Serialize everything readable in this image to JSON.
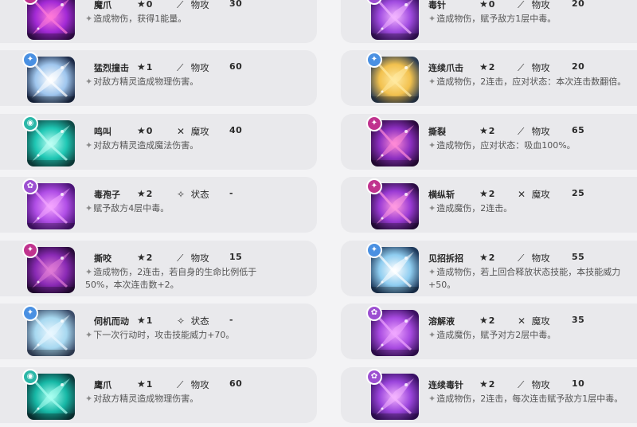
{
  "colors": {
    "badge_physical": "#4a90e2",
    "badge_magic": "#2bb7a8",
    "badge_poison": "#9c4fd1",
    "badge_dark": "#c0338e"
  },
  "skills": [
    {
      "name": "魔爪",
      "cost": "0",
      "type_icon": "dagger-icon",
      "type": "物攻",
      "power": "30",
      "desc": "造成物伤，获得1能量。",
      "badge_color": "#c0338e",
      "badge_glyph": "✦",
      "art": [
        "#3a0f55",
        "#a32ad6",
        "#ff7ad8"
      ]
    },
    {
      "name": "猛烈撞击",
      "cost": "1",
      "type_icon": "dagger-icon",
      "type": "物攻",
      "power": "60",
      "desc": "对敌方精灵造成物理伤害。",
      "badge_color": "#4a90e2",
      "badge_glyph": "✦",
      "art": [
        "#1d2b48",
        "#9fc6ee",
        "#ffffff"
      ]
    },
    {
      "name": "鸣叫",
      "cost": "0",
      "type_icon": "wand-icon",
      "type": "魔攻",
      "power": "40",
      "desc": "对敌方精灵造成魔法伤害。",
      "badge_color": "#2bb7a8",
      "badge_glyph": "◉",
      "art": [
        "#0f4b48",
        "#1fc7b4",
        "#bdfff4"
      ]
    },
    {
      "name": "毒孢子",
      "cost": "2",
      "type_icon": "sparkle-icon",
      "type": "状态",
      "power": "-",
      "desc": "赋予敌方4层中毒。",
      "badge_color": "#9c4fd1",
      "badge_glyph": "✿",
      "art": [
        "#4c1478",
        "#b04ee6",
        "#f4a6ff"
      ]
    },
    {
      "name": "撕咬",
      "cost": "2",
      "type_icon": "dagger-icon",
      "type": "物攻",
      "power": "15",
      "desc": "造成物伤，2连击，若自身的生命比例低于50%，本次连击数+2。",
      "badge_color": "#c0338e",
      "badge_glyph": "✦",
      "art": [
        "#2a0b3c",
        "#8a2ab5",
        "#e07bd6"
      ]
    },
    {
      "name": "伺机而动",
      "cost": "1",
      "type_icon": "sparkle-icon",
      "type": "状态",
      "power": "-",
      "desc": "下一次行动时，攻击技能威力+70。",
      "badge_color": "#4a90e2",
      "badge_glyph": "✦",
      "art": [
        "#3c4d6a",
        "#a7d8f0",
        "#e9f7ff"
      ]
    },
    {
      "name": "鹰爪",
      "cost": "1",
      "type_icon": "dagger-icon",
      "type": "物攻",
      "power": "60",
      "desc": "对敌方精灵造成物理伤害。",
      "badge_color": "#2bb7a8",
      "badge_glyph": "◉",
      "art": [
        "#0c3b3d",
        "#17b8a6",
        "#a9fff1"
      ]
    },
    {
      "name": "毒针",
      "cost": "0",
      "type_icon": "dagger-icon",
      "type": "物攻",
      "power": "20",
      "desc": "造成物伤，赋予敌方1层中毒。",
      "badge_color": "#9c4fd1",
      "badge_glyph": "✿",
      "art": [
        "#3a1262",
        "#a04be0",
        "#f2b5ff"
      ]
    },
    {
      "name": "连续爪击",
      "cost": "2",
      "type_icon": "dagger-icon",
      "type": "物攻",
      "power": "20",
      "desc": "造成物伤，2连击，应对状态：本次连击数翻倍。",
      "badge_color": "#4a90e2",
      "badge_glyph": "✦",
      "art": [
        "#2e3e52",
        "#f2c14e",
        "#ffe9a1"
      ]
    },
    {
      "name": "撕裂",
      "cost": "2",
      "type_icon": "dagger-icon",
      "type": "物攻",
      "power": "65",
      "desc": "造成物伤，应对状态：吸血100%。",
      "badge_color": "#c0338e",
      "badge_glyph": "✦",
      "art": [
        "#2d0b3f",
        "#8c2fc0",
        "#ff8ad6"
      ]
    },
    {
      "name": "横纵斩",
      "cost": "2",
      "type_icon": "wand-icon",
      "type": "魔攻",
      "power": "25",
      "desc": "造成魔伤，2连击。",
      "badge_color": "#c0338e",
      "badge_glyph": "✦",
      "art": [
        "#2c0d44",
        "#9a3ad4",
        "#ff9ae0"
      ]
    },
    {
      "name": "见招拆招",
      "cost": "2",
      "type_icon": "dagger-icon",
      "type": "物攻",
      "power": "55",
      "desc": "造成物伤，若上回合释放状态技能，本技能威力+50。",
      "badge_color": "#4a90e2",
      "badge_glyph": "✦",
      "art": [
        "#1f3a5c",
        "#8fcdf0",
        "#ffffff"
      ]
    },
    {
      "name": "溶解液",
      "cost": "2",
      "type_icon": "wand-icon",
      "type": "魔攻",
      "power": "35",
      "desc": "造成魔伤，赋予对方2层中毒。",
      "badge_color": "#9c4fd1",
      "badge_glyph": "✿",
      "art": [
        "#3b1160",
        "#a74ae0",
        "#f0a7ff"
      ]
    },
    {
      "name": "连续毒针",
      "cost": "2",
      "type_icon": "dagger-icon",
      "type": "物攻",
      "power": "10",
      "desc": "造成物伤，2连击，每次连击赋予敌方1层中毒。",
      "badge_color": "#9c4fd1",
      "badge_glyph": "✿",
      "art": [
        "#381063",
        "#9b45dc",
        "#f4b4ff"
      ]
    }
  ]
}
